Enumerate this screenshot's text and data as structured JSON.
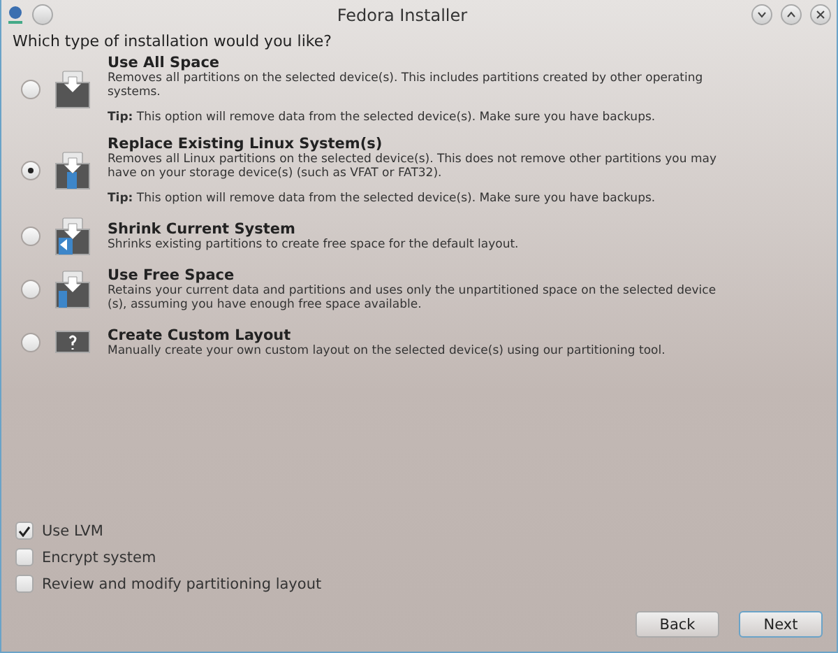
{
  "window": {
    "title": "Fedora Installer"
  },
  "question": "Which type of installation would you like?",
  "options": [
    {
      "kind": "all",
      "title": "Use All Space",
      "description": "Removes all partitions on the selected device(s).  This includes partitions created by other operating systems.",
      "tip": "**Tip:** This option will remove data from the selected device(s).  Make sure you have backups.",
      "selected": false
    },
    {
      "kind": "replace",
      "title": "Replace Existing Linux System(s)",
      "description": "Removes all Linux partitions on the selected device(s). This does not remove other partitions you may have on your storage device(s) (such as VFAT or FAT32).",
      "tip": "**Tip:** This option will remove data from the selected device(s).  Make sure you have backups.",
      "selected": true
    },
    {
      "kind": "shrink",
      "title": "Shrink Current System",
      "description": "Shrinks existing partitions to create free space for the default layout.",
      "selected": false
    },
    {
      "kind": "free",
      "title": "Use Free Space",
      "description": "Retains your current data and partitions and uses only the unpartitioned space on the selected device (s), assuming you have enough free space available.",
      "selected": false
    },
    {
      "kind": "custom",
      "title": "Create Custom Layout",
      "description": "Manually create your own custom layout on the selected device(s) using our partitioning tool.",
      "selected": false
    }
  ],
  "checkboxes": [
    {
      "label": "Use LVM",
      "checked": true
    },
    {
      "label": "Encrypt system",
      "checked": false
    },
    {
      "label": "Review and modify partitioning layout",
      "checked": false
    }
  ],
  "buttons": [
    {
      "label": "Back",
      "default": false
    },
    {
      "label": "Next",
      "default": true
    }
  ]
}
